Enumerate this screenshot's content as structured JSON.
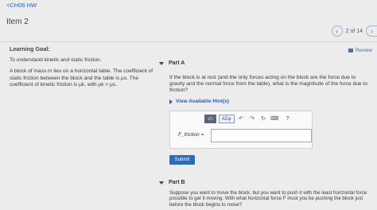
{
  "nav": {
    "back_label": "<CH06 HW"
  },
  "item": {
    "title": "Item 2"
  },
  "pager": {
    "prev_icon": "chevron-left",
    "count": "2 of 14",
    "next_icon": "chevron-right"
  },
  "review": {
    "label": "Review"
  },
  "learning_goal": {
    "title": "Learning Goal:",
    "goal": "To understand kinetic and static friction.",
    "description": "A block of mass m lies on a horizontal table. The coefficient of static friction between the block and the table is μs. The coefficient of kinetic friction is μk, with μk < μs."
  },
  "part_a": {
    "label": "Part A",
    "question": "If the block is at rest (and the only forces acting on the block are the force due to gravity and the normal force from the table), what is the magnitude of the force due to friction?",
    "hints_label": "View Available Hint(s)",
    "toolbar": {
      "template_btn": "√□",
      "greek_btn": "ΑΣφ",
      "help": "?"
    },
    "equation_label": "F_friction =",
    "answer_value": "",
    "submit_label": "Submit"
  },
  "part_b": {
    "label": "Part B",
    "question": "Suppose you want to move the block, but you want to push it with the least horizontal force possible to get it moving. With what horizontal force F must you be pushing the block just before the block begins to move?"
  }
}
